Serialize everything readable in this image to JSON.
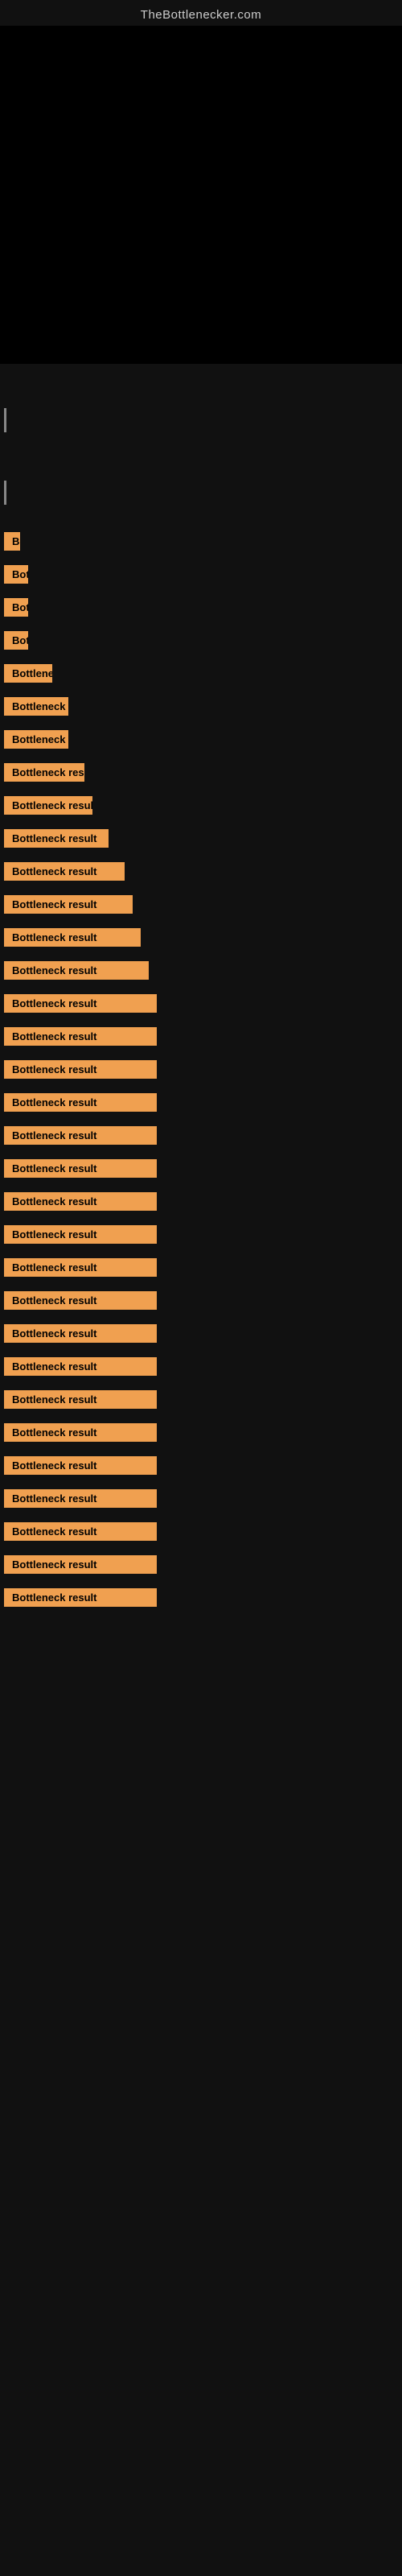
{
  "header": {
    "title": "TheBottlenecker.com"
  },
  "labels": {
    "bottleneck_result": "Bottleneck result"
  },
  "rows": [
    {
      "id": 1,
      "width_class": "w-20",
      "visible": false,
      "gap": "section-gap"
    },
    {
      "id": 2,
      "width_class": "w-20",
      "visible": false,
      "gap": "section-gap"
    },
    {
      "id": 3,
      "width_class": "w-20",
      "visible": false,
      "gap": "medium-gap"
    },
    {
      "id": 4,
      "width_class": "w-20",
      "visible": false,
      "gap": "small-gap"
    },
    {
      "id": 5,
      "width_class": "w-20",
      "visible": false,
      "gap": "small-gap"
    },
    {
      "id": 6,
      "width_class": "w-30",
      "visible": false,
      "gap": "small-gap"
    },
    {
      "id": 7,
      "width_class": "w-30",
      "visible": false,
      "gap": "small-gap"
    },
    {
      "id": 8,
      "width_class": "w-30",
      "visible": false,
      "gap": "small-gap"
    },
    {
      "id": 9,
      "width_class": "w-40",
      "visible": false,
      "gap": "small-gap"
    },
    {
      "id": 10,
      "width_class": "w-60",
      "visible": false,
      "gap": "small-gap"
    },
    {
      "id": 11,
      "width_class": "w-80",
      "visible": false,
      "gap": "small-gap"
    },
    {
      "id": 12,
      "width_class": "w-100",
      "visible": false,
      "gap": "small-gap"
    },
    {
      "id": 13,
      "width_class": "w-110",
      "visible": false,
      "gap": "small-gap"
    },
    {
      "id": 14,
      "width_class": "w-130",
      "visible": false,
      "gap": "small-gap"
    },
    {
      "id": 15,
      "width_class": "w-150",
      "visible": false,
      "gap": "small-gap"
    },
    {
      "id": 16,
      "width_class": "w-160",
      "visible": false,
      "gap": "small-gap"
    },
    {
      "id": 17,
      "width_class": "w-170",
      "visible": false,
      "gap": "small-gap"
    },
    {
      "id": 18,
      "width_class": "w-180",
      "visible": false,
      "gap": "small-gap"
    },
    {
      "id": 19,
      "width_class": "w-full",
      "visible": true,
      "gap": "small-gap"
    },
    {
      "id": 20,
      "width_class": "w-full",
      "visible": true,
      "gap": "small-gap"
    },
    {
      "id": 21,
      "width_class": "w-full",
      "visible": true,
      "gap": "small-gap"
    },
    {
      "id": 22,
      "width_class": "w-full",
      "visible": true,
      "gap": "small-gap"
    },
    {
      "id": 23,
      "width_class": "w-full",
      "visible": true,
      "gap": "small-gap"
    },
    {
      "id": 24,
      "width_class": "w-full",
      "visible": true,
      "gap": "small-gap"
    },
    {
      "id": 25,
      "width_class": "w-full",
      "visible": true,
      "gap": "small-gap"
    },
    {
      "id": 26,
      "width_class": "w-full",
      "visible": true,
      "gap": "small-gap"
    },
    {
      "id": 27,
      "width_class": "w-full",
      "visible": true,
      "gap": "small-gap"
    },
    {
      "id": 28,
      "width_class": "w-full",
      "visible": true,
      "gap": "small-gap"
    },
    {
      "id": 29,
      "width_class": "w-full",
      "visible": true,
      "gap": "small-gap"
    },
    {
      "id": 30,
      "width_class": "w-full",
      "visible": true,
      "gap": "small-gap"
    },
    {
      "id": 31,
      "width_class": "w-full",
      "visible": true,
      "gap": "small-gap"
    },
    {
      "id": 32,
      "width_class": "w-full",
      "visible": true,
      "gap": "small-gap"
    },
    {
      "id": 33,
      "width_class": "w-full",
      "visible": true,
      "gap": "small-gap"
    }
  ]
}
